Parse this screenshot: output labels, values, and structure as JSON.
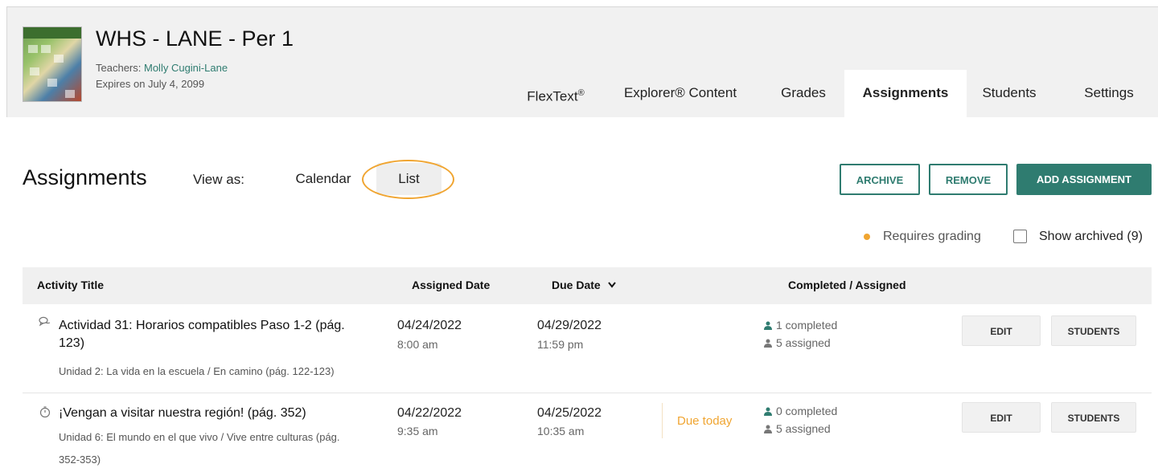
{
  "course": {
    "title": "WHS - LANE - Per 1",
    "teachers_label": "Teachers:",
    "teacher_name": "Molly Cugini-Lane",
    "expires": "Expires on July 4, 2099"
  },
  "tabs": [
    {
      "label": "FlexText",
      "sup": "®"
    },
    {
      "label": "Explorer® Content"
    },
    {
      "label": "Grades"
    },
    {
      "label": "Assignments"
    },
    {
      "label": "Students"
    },
    {
      "label": "Settings"
    }
  ],
  "active_tab": "Assignments",
  "toolbar": {
    "page_title": "Assignments",
    "view_as_label": "View as:",
    "calendar_label": "Calendar",
    "list_label": "List",
    "archive_label": "ARCHIVE",
    "remove_label": "REMOVE",
    "add_label": "ADD ASSIGNMENT"
  },
  "legend": {
    "requires_grading": "Requires grading",
    "show_archived": "Show archived (9)",
    "show_archived_checked": false
  },
  "colors": {
    "accent": "#2f7c70",
    "highlight": "#f0a531",
    "due_today": "#f0a531"
  },
  "table": {
    "headers": {
      "title": "Activity Title",
      "assigned": "Assigned Date",
      "due": "Due Date",
      "completed": "Completed / Assigned"
    },
    "rows": [
      {
        "icon": "speech-bubbles-icon",
        "title_line1": "Actividad 31: Horarios compatibles Paso 1-2 (pág.",
        "title_line2": "123)",
        "subtitle_line1": "Unidad 2: La vida en la escuela / En camino (pág. 122-123)",
        "subtitle_line2": "",
        "assigned_date": "04/24/2022",
        "assigned_time": "8:00 am",
        "due_date": "04/29/2022",
        "due_time": "11:59 pm",
        "due_status": "",
        "completed": "1 completed",
        "assigned": "5 assigned",
        "edit_label": "EDIT",
        "students_label": "STUDENTS"
      },
      {
        "icon": "stopwatch-icon",
        "title_line1": "¡Vengan a visitar nuestra región! (pág. 352)",
        "title_line2": "",
        "subtitle_line1": "Unidad 6: El mundo en el que vivo / Vive entre culturas (pág.",
        "subtitle_line2": "352-353)",
        "assigned_date": "04/22/2022",
        "assigned_time": "9:35 am",
        "due_date": "04/25/2022",
        "due_time": "10:35 am",
        "due_status": "Due today",
        "completed": "0 completed",
        "assigned": "5 assigned",
        "edit_label": "EDIT",
        "students_label": "STUDENTS"
      }
    ]
  }
}
